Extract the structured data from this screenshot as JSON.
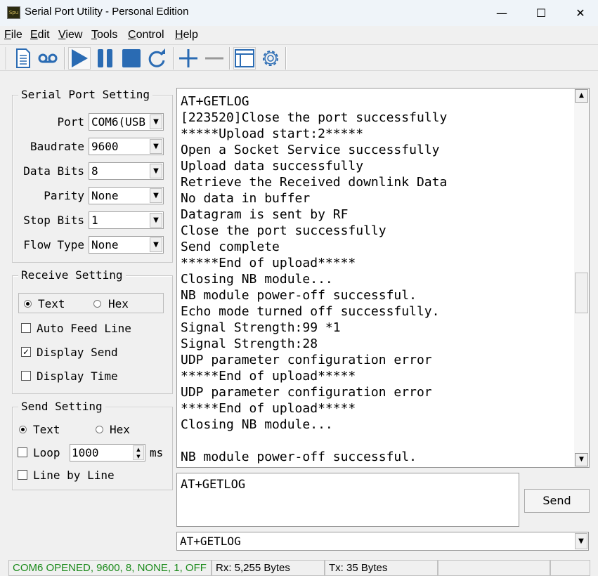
{
  "window": {
    "title": "Serial Port Utility - Personal Edition",
    "app_icon_text": "SPU",
    "minimize": "—",
    "maximize": "☐",
    "close": "✕"
  },
  "menu": [
    {
      "label": "File",
      "key": "F"
    },
    {
      "label": "Edit",
      "key": "E"
    },
    {
      "label": "View",
      "key": "V"
    },
    {
      "label": "Tools",
      "key": "T"
    },
    {
      "label": "Control",
      "key": "C"
    },
    {
      "label": "Help",
      "key": "H"
    }
  ],
  "toolbar": {
    "icons": [
      "document-icon",
      "record-icon",
      "play-icon",
      "pause-icon",
      "stop-icon",
      "refresh-icon",
      "plus-icon",
      "minus-icon",
      "window-icon",
      "gear-icon"
    ],
    "accent": "#2a6bb3"
  },
  "serial": {
    "title": "Serial Port Setting",
    "port_label": "Port",
    "port": "COM6(USB",
    "baud_label": "Baudrate",
    "baud": "9600",
    "databits_label": "Data Bits",
    "databits": "8",
    "parity_label": "Parity",
    "parity": "None",
    "stopbits_label": "Stop Bits",
    "stopbits": "1",
    "flow_label": "Flow Type",
    "flow": "None"
  },
  "receive": {
    "title": "Receive Setting",
    "text": "Text",
    "hex": "Hex",
    "mode": "Text",
    "auto_feed": "Auto Feed Line",
    "display_send": "Display Send",
    "display_time": "Display Time",
    "auto_feed_checked": false,
    "display_send_checked": true,
    "display_time_checked": false
  },
  "send": {
    "title": "Send Setting",
    "text": "Text",
    "hex": "Hex",
    "mode": "Text",
    "loop": "Loop",
    "loop_value": "1000",
    "ms": "ms",
    "line_by_line": "Line by Line"
  },
  "log": {
    "lines": [
      "AT+GETLOG",
      "[223520]Close the port successfully",
      "*****Upload start:2*****",
      "Open a Socket Service successfully",
      "Upload data successfully",
      "Retrieve the Received downlink Data",
      "No data in buffer",
      "Datagram is sent by RF",
      "Close the port successfully",
      "Send complete",
      "*****End of upload*****",
      "Closing NB module...",
      "NB module power-off successful.",
      "Echo mode turned off successfully.",
      "Signal Strength:99 *1",
      "Signal Strength:28",
      "UDP parameter configuration error",
      "*****End of upload*****",
      "UDP parameter configuration error",
      "*****End of upload*****",
      "Closing NB module...",
      "",
      "NB module power-off successful.",
      "Echo mode turned off successfully."
    ]
  },
  "input": {
    "value": "AT+GETLOG",
    "send_label": "Send",
    "history_value": "AT+GETLOG"
  },
  "status": {
    "connection": "COM6 OPENED, 9600, 8, NONE, 1, OFF",
    "rx": "Rx: 5,255 Bytes",
    "tx": "Tx: 35 Bytes",
    "connection_color": "#1a8a1a"
  }
}
